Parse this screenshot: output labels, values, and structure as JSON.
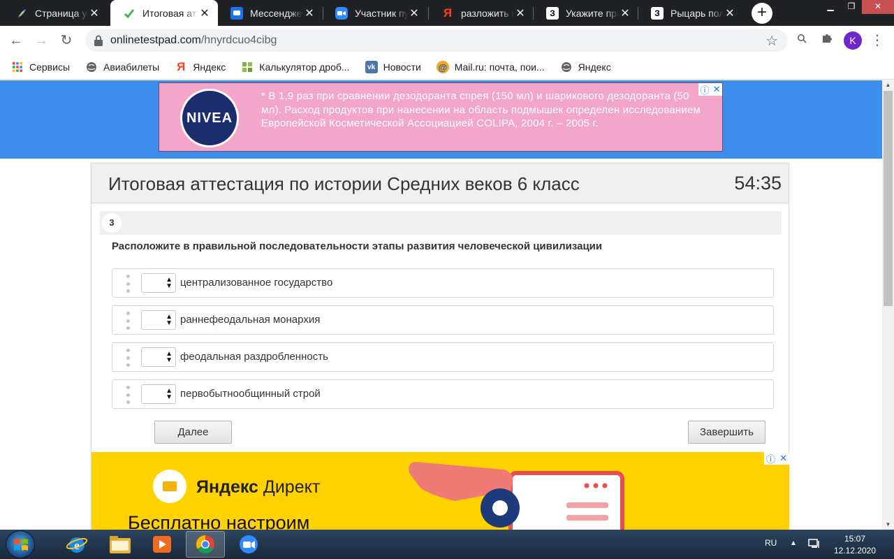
{
  "browser": {
    "tabs": [
      {
        "title": "Страница уро",
        "icon": "feather-icon",
        "active": false
      },
      {
        "title": "Итоговая атт",
        "icon": "testpad-icon",
        "active": true
      },
      {
        "title": "Мессенджер",
        "icon": "messenger-icon",
        "active": false
      },
      {
        "title": "Участник пуб",
        "icon": "zoom-icon",
        "active": false
      },
      {
        "title": "разложить пр",
        "icon": "yandex-icon",
        "active": false
      },
      {
        "title": "Укажите пра",
        "icon": "znanija-icon",
        "active": false
      },
      {
        "title": "Рыцарь полу",
        "icon": "znanija-icon",
        "active": false
      }
    ],
    "url_host": "onlinetestpad.com",
    "url_path": "/hnyrdcuo4cibg",
    "profile_initial": "K",
    "bookmarks": [
      {
        "label": "Сервисы",
        "icon": "apps-grid-icon"
      },
      {
        "label": "Авиабилеты",
        "icon": "globe-icon"
      },
      {
        "label": "Яндекс",
        "icon": "yandex-icon"
      },
      {
        "label": "Калькулятор дроб...",
        "icon": "calculator-icon"
      },
      {
        "label": "Новости",
        "icon": "vk-icon"
      },
      {
        "label": "Mail.ru: почта, пои...",
        "icon": "mailru-icon"
      },
      {
        "label": "Яндекс",
        "icon": "globe-icon"
      }
    ]
  },
  "ad_top": {
    "logo": "NIVEA",
    "text": "* В 1,9 раз при сравнении дезодоранта спрея (150 мл) и шарикового дезодоранта (50 мл). Расход продуктов при нанесении на область подмышек определен исследованием Европейской Косметической Ассоциацией COLIPA, 2004 г. – 2005 г."
  },
  "test": {
    "title": "Итоговая аттестация по истории Средних веков 6 класс",
    "timer": "54:35",
    "question_number": "3",
    "question_text": "Расположите в правильной последовательности этапы развития человеческой цивилизации",
    "items": [
      {
        "label": "централизованное государство",
        "selected": ""
      },
      {
        "label": "раннефеодальная монархия",
        "selected": ""
      },
      {
        "label": "феодальная раздробленность",
        "selected": ""
      },
      {
        "label": "первобытнообщинный строй",
        "selected": ""
      }
    ],
    "next_label": "Далее",
    "finish_label": "Завершить"
  },
  "ad_bottom": {
    "brand": "Яндекс",
    "brand_suffix": "Директ",
    "headline": "Бесплатно настроим"
  },
  "taskbar": {
    "lang": "RU",
    "time": "15:07",
    "date": "12.12.2020"
  },
  "colors": {
    "page_band": "#3d8eec",
    "ad_top_bg": "#f3a5ca",
    "ad_bottom_bg": "#ffd200",
    "profile": "#6c26c9"
  }
}
